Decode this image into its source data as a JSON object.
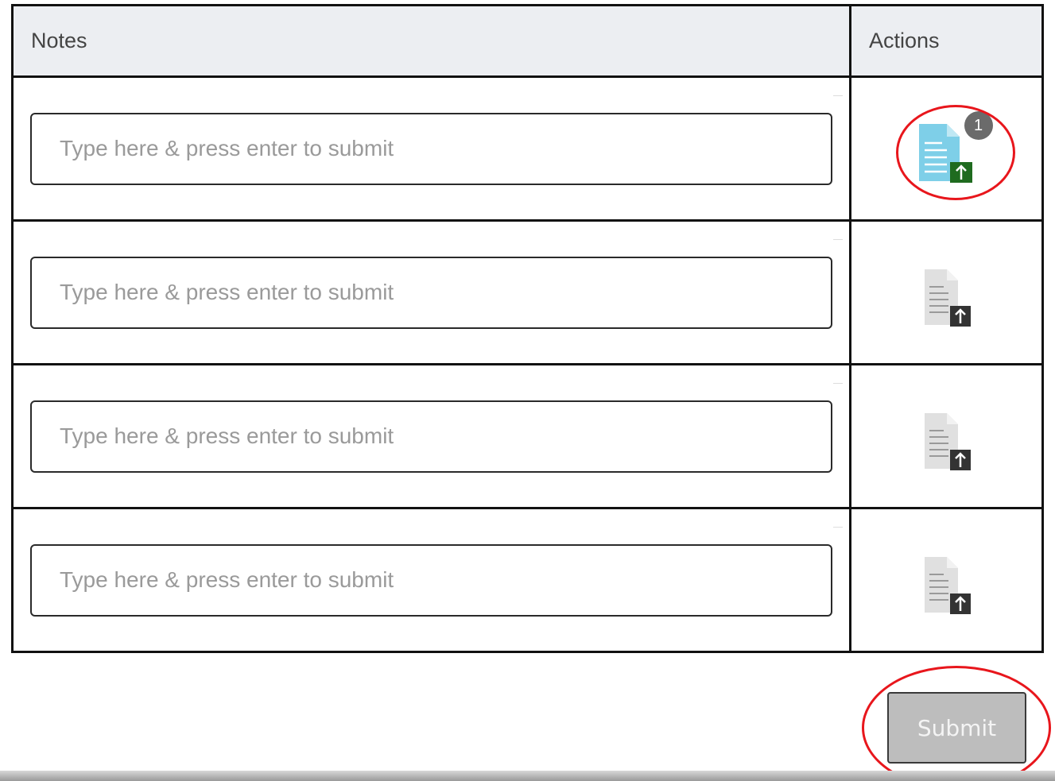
{
  "table": {
    "headers": {
      "notes": "Notes",
      "actions": "Actions"
    },
    "rows": [
      {
        "note_value": "",
        "note_placeholder": "Type here & press enter to submit",
        "attachment_icon": "document-upload-icon",
        "attachment_state": "active",
        "attachment_count": "1"
      },
      {
        "note_value": "",
        "note_placeholder": "Type here & press enter to submit",
        "attachment_icon": "document-upload-icon",
        "attachment_state": "inactive"
      },
      {
        "note_value": "",
        "note_placeholder": "Type here & press enter to submit",
        "attachment_icon": "document-upload-icon",
        "attachment_state": "inactive"
      },
      {
        "note_value": "",
        "note_placeholder": "Type here & press enter to submit",
        "attachment_icon": "document-upload-icon",
        "attachment_state": "inactive"
      }
    ]
  },
  "submit": {
    "label": "Submit"
  },
  "colors": {
    "header_bg": "#eceef2",
    "active_doc": "#7ecfe8",
    "active_upload": "#1f6b1f",
    "inactive_doc": "#e0e0e0",
    "inactive_upload": "#333333",
    "badge": "#6b6b6b",
    "highlight": "#e8161c",
    "submit_bg": "#bdbdbd"
  }
}
